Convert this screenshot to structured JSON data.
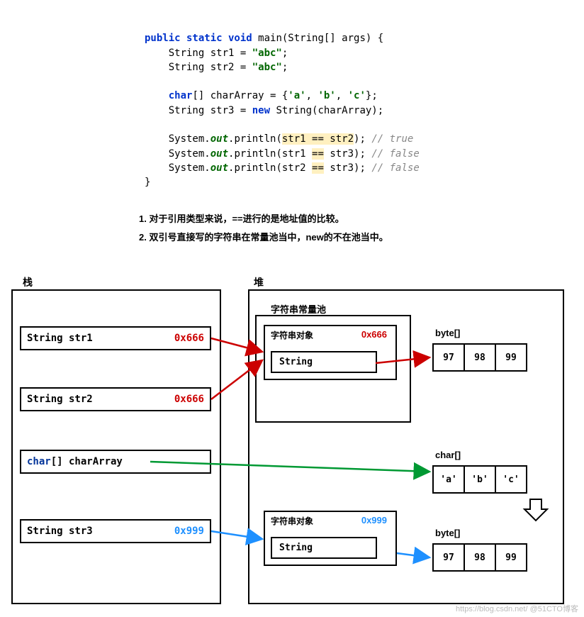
{
  "code": {
    "l1_pre": "public static void ",
    "l1_main": "main",
    "l1_rest": "(String[] args) {",
    "l2_pre": "    String str1 = ",
    "l2_lit": "\"abc\"",
    "l2_end": ";",
    "l3_pre": "    String str2 = ",
    "l3_lit": "\"abc\"",
    "l3_end": ";",
    "l4_pre": "    ",
    "l4_char": "char",
    "l4_mid": "[] charArray = {",
    "l4_a": "'a'",
    "l4_comma1": ", ",
    "l4_b": "'b'",
    "l4_comma2": ", ",
    "l4_c": "'c'",
    "l4_end": "};",
    "l5_pre": "    String str3 = ",
    "l5_new": "new ",
    "l5_end": "String(charArray);",
    "l6_pre": "    System.",
    "l6_out": "out",
    "l6_mid": ".println(",
    "l6_hl": "str1 == str2",
    "l6_end": "); ",
    "l6_comment": "// true",
    "l7_pre": "    System.",
    "l7_out": "out",
    "l7_mid": ".println(str1 ",
    "l7_hl": "==",
    "l7_end": " str3); ",
    "l7_comment": "// false",
    "l8_pre": "    System.",
    "l8_out": "out",
    "l8_mid": ".println(str2 ",
    "l8_hl": "==",
    "l8_end": " str3); ",
    "l8_comment": "// false",
    "l9": "}"
  },
  "notes": {
    "n1": "1. 对于引用类型来说，==进行的是地址值的比较。",
    "n2": "2. 双引号直接写的字符串在常量池当中，new的不在池当中。"
  },
  "stack": {
    "title": "栈",
    "str1": {
      "label": "String str1",
      "addr": "0x666"
    },
    "str2": {
      "label": "String str2",
      "addr": "0x666"
    },
    "charArray": {
      "kw": "char",
      "rest": "[] charArray"
    },
    "str3": {
      "label": "String str3",
      "addr": "0x999"
    }
  },
  "heap": {
    "title": "堆",
    "pool_label": "字符串常量池",
    "obj1": {
      "label": "字符串对象",
      "addr": "0x666",
      "str": "String"
    },
    "obj2": {
      "label": "字符串对象",
      "addr": "0x999",
      "str": "String"
    },
    "byte_label": "byte[]",
    "char_label": "char[]",
    "bytes": [
      "97",
      "98",
      "99"
    ],
    "chars": [
      "'a'",
      "'b'",
      "'c'"
    ],
    "bytes2": [
      "97",
      "98",
      "99"
    ]
  },
  "watermark": "https://blog.csdn.net/ @51CTO博客"
}
